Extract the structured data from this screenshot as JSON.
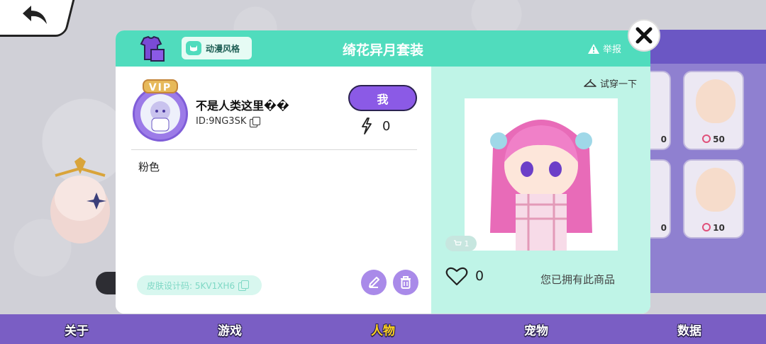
{
  "modal": {
    "title": "绮花异月套装",
    "style_badge": "动漫风格",
    "report": "举报",
    "user": {
      "vip": "VIP",
      "name": "不是人类这里��",
      "id": "ID:9NG3SK",
      "me_button": "我",
      "energy": "0"
    },
    "description": "粉色",
    "design_code": "皮肤设计码: 5KV1XH6",
    "try_on": "试穿一下",
    "cart_count": "1",
    "likes": "0",
    "owned_text": "您已拥有此商品"
  },
  "shop": {
    "prices": [
      "50",
      "10"
    ],
    "partial_prices": [
      "0",
      "0"
    ]
  },
  "bottom_nav": [
    {
      "label": "关于",
      "active": false
    },
    {
      "label": "游戏",
      "active": false
    },
    {
      "label": "人物",
      "active": true
    },
    {
      "label": "宠物",
      "active": false
    },
    {
      "label": "数据",
      "active": false
    }
  ],
  "colors": {
    "accent_mint": "#50dcbd",
    "purple": "#7a5ec4",
    "active_nav": "#ffd21e"
  }
}
